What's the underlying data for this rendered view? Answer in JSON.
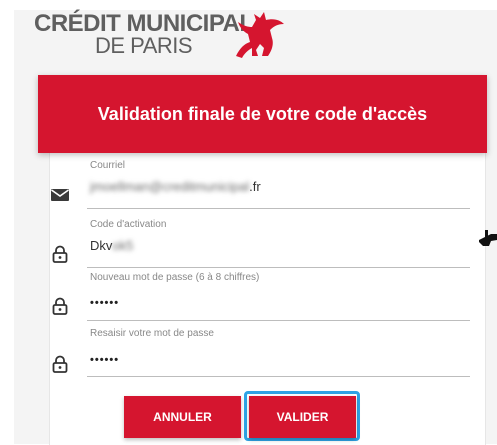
{
  "logo": {
    "line1": "CRÉDIT MUNICIPAL",
    "line2": "DE PARIS"
  },
  "banner": {
    "title": "Validation finale de votre code d'accès"
  },
  "fields": {
    "email": {
      "label": "Courriel",
      "value_hidden": "jmoellman@creditmunicipal",
      "value_suffix": ".fr"
    },
    "activation": {
      "label": "Code d'activation",
      "value_prefix": "Dkv",
      "value_hidden": "ok5"
    },
    "new_password": {
      "label": "Nouveau mot de passe (6 à 8 chiffres)",
      "value": "••••••"
    },
    "confirm_password": {
      "label": "Resaisir votre mot de passe",
      "value": "••••••"
    }
  },
  "buttons": {
    "cancel": "ANNULER",
    "validate": "VALIDER"
  },
  "colors": {
    "brand_red": "#d5152f",
    "highlight": "#2ea3e5",
    "logo_gray": "#5f5f5f"
  },
  "icons": {
    "email": "envelope-icon",
    "lock": "lock-icon",
    "logo": "griffin-logo-icon"
  }
}
